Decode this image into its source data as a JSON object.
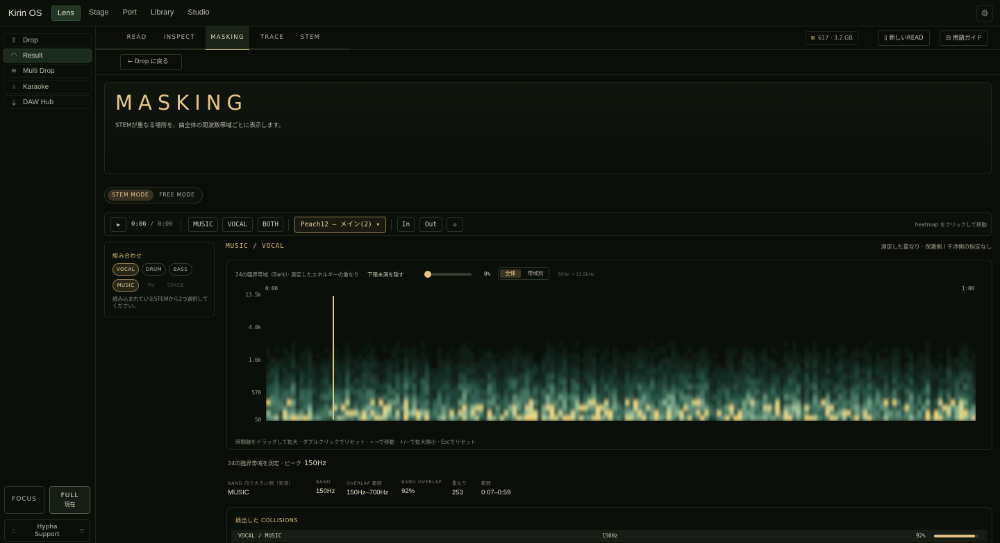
{
  "app": {
    "title": "Kirin OS",
    "nav": [
      "Lens",
      "Stage",
      "Port",
      "Library",
      "Studio"
    ],
    "active_nav": "Lens"
  },
  "sidebar": {
    "items": [
      {
        "label": "Drop",
        "icon": "upload-icon"
      },
      {
        "label": "Result",
        "icon": "gauge-icon"
      },
      {
        "label": "Multi Drop",
        "icon": "layers-icon"
      },
      {
        "label": "Karaoke",
        "icon": "microphone-icon"
      },
      {
        "label": "DAW Hub",
        "icon": "plug-icon"
      }
    ],
    "active": "Result",
    "focus_label": "FOCUS",
    "full_label": "FULL",
    "full_sub": "現在",
    "support": "Hypha Support"
  },
  "tabs": {
    "items": [
      "READ",
      "INSPECT",
      "MASKING",
      "TRACE",
      "STEM"
    ],
    "active": "MASKING",
    "stat": "617 · 3.2 GB",
    "new_read": "新しいREAD",
    "glossary": "用語ガイド"
  },
  "back_label": "Drop に戻る",
  "hero": {
    "title": "MASKING",
    "desc": "STEMが重なる場所を、曲全体の周波数帯域ごとに表示します。"
  },
  "mode_toggle": {
    "stem": "STEM MODE",
    "free": "FREE MODE",
    "active": "STEM MODE"
  },
  "controls": {
    "time_current": "0:06",
    "time_total": "0:00",
    "sources": [
      "MUSIC",
      "VOCAL",
      "BOTH"
    ],
    "track": "Peach12 – メイン(2) ▾",
    "in_label": "In",
    "out_label": "Out",
    "reset_icon": "diamond-icon",
    "hint": "heatmap をクリックして移動"
  },
  "combo": {
    "title": "組み合わせ",
    "chips": [
      "VOCAL",
      "DRUM",
      "BASS",
      "MUSIC",
      "RV",
      "SPACE"
    ],
    "selected": [
      "VOCAL",
      "MUSIC"
    ],
    "note": "読み込まれているSTEMから2つ選択してください。"
  },
  "pair": {
    "title": "MUSIC / VOCAL",
    "legend": "測定した重なり · 保護側 / 干渉側の指定なし"
  },
  "heatmap": {
    "caption": "24の臨界帯域（Bark）· 測定したエネルギーの重なり",
    "threshold_label": "下限未満を隠す",
    "threshold_pct": "0%",
    "threshold_value": 0,
    "seg_all": "全体",
    "seg_band": "帯域別",
    "freq_range": "50Hz → 13.5kHz",
    "t_start": "0:00",
    "t_end": "1:00",
    "y_ticks": [
      "13.5k",
      "4.0k",
      "1.6k",
      "570",
      "50"
    ],
    "playhead_time": "0:06",
    "footer": "時間軸をドラッグして拡大 · ダブルクリックでリセット · ←→で移動 · +/−で拡大縮小 · Escでリセット"
  },
  "summary": {
    "label": "24の臨界帯域を測定 · ピーク",
    "peak": "150Hz",
    "metrics": [
      {
        "k": "BAND 内で大きい側（実測）",
        "v": "MUSIC"
      },
      {
        "k": "BAND",
        "v": "150Hz"
      },
      {
        "k": "OVERLAP 範囲",
        "v": "150Hz–700Hz"
      },
      {
        "k": "BAND OVERLAP",
        "v": "92%"
      },
      {
        "k": "重なり",
        "v": "253"
      },
      {
        "k": "範囲",
        "v": "0:07–0:59"
      }
    ]
  },
  "collisions": {
    "title": "検出した COLLISIONS",
    "rows": [
      {
        "pair": "VOCAL / MUSIC",
        "band": "150Hz",
        "pct": "92%",
        "value": 0.92
      }
    ]
  },
  "colors": {
    "accent": "#e5c57f",
    "bg": "#0a0d08",
    "heat_low": "#1d4a3a",
    "heat_mid": "#5fb7a3",
    "heat_high": "#f2d27a"
  }
}
